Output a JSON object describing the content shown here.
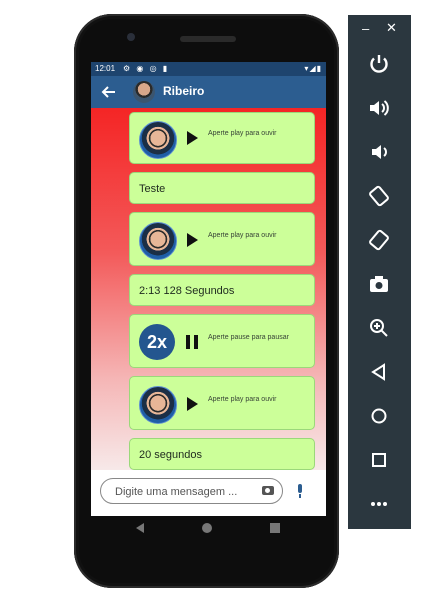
{
  "statusbar": {
    "time": "12:01"
  },
  "appbar": {
    "contact_name": "Ribeiro"
  },
  "messages": [
    {
      "type": "audio",
      "hint": "Aperte play para ouvir"
    },
    {
      "type": "text",
      "text": "Teste"
    },
    {
      "type": "audio",
      "hint": "Aperte play para ouvir"
    },
    {
      "type": "text",
      "text": "2:13 128 Segundos"
    },
    {
      "type": "audio-playing",
      "speed": "2x",
      "hint": "Aperte pause para pausar"
    },
    {
      "type": "audio",
      "hint": "Aperte play para ouvir"
    },
    {
      "type": "text",
      "text": "20 segundos"
    }
  ],
  "composer": {
    "placeholder": "Digite uma mensagem ..."
  },
  "emulator_panel": {
    "minimize": "–",
    "close": "✕",
    "tools": [
      "power-icon",
      "volume-up-icon",
      "volume-down-icon",
      "rotate-left-icon",
      "rotate-right-icon",
      "camera-icon",
      "zoom-icon",
      "back-icon",
      "home-icon",
      "overview-icon",
      "more-icon"
    ]
  },
  "colors": {
    "appbar": "#2c5d90",
    "bubble": "#ccff99",
    "gradient_top": "#f42525"
  }
}
